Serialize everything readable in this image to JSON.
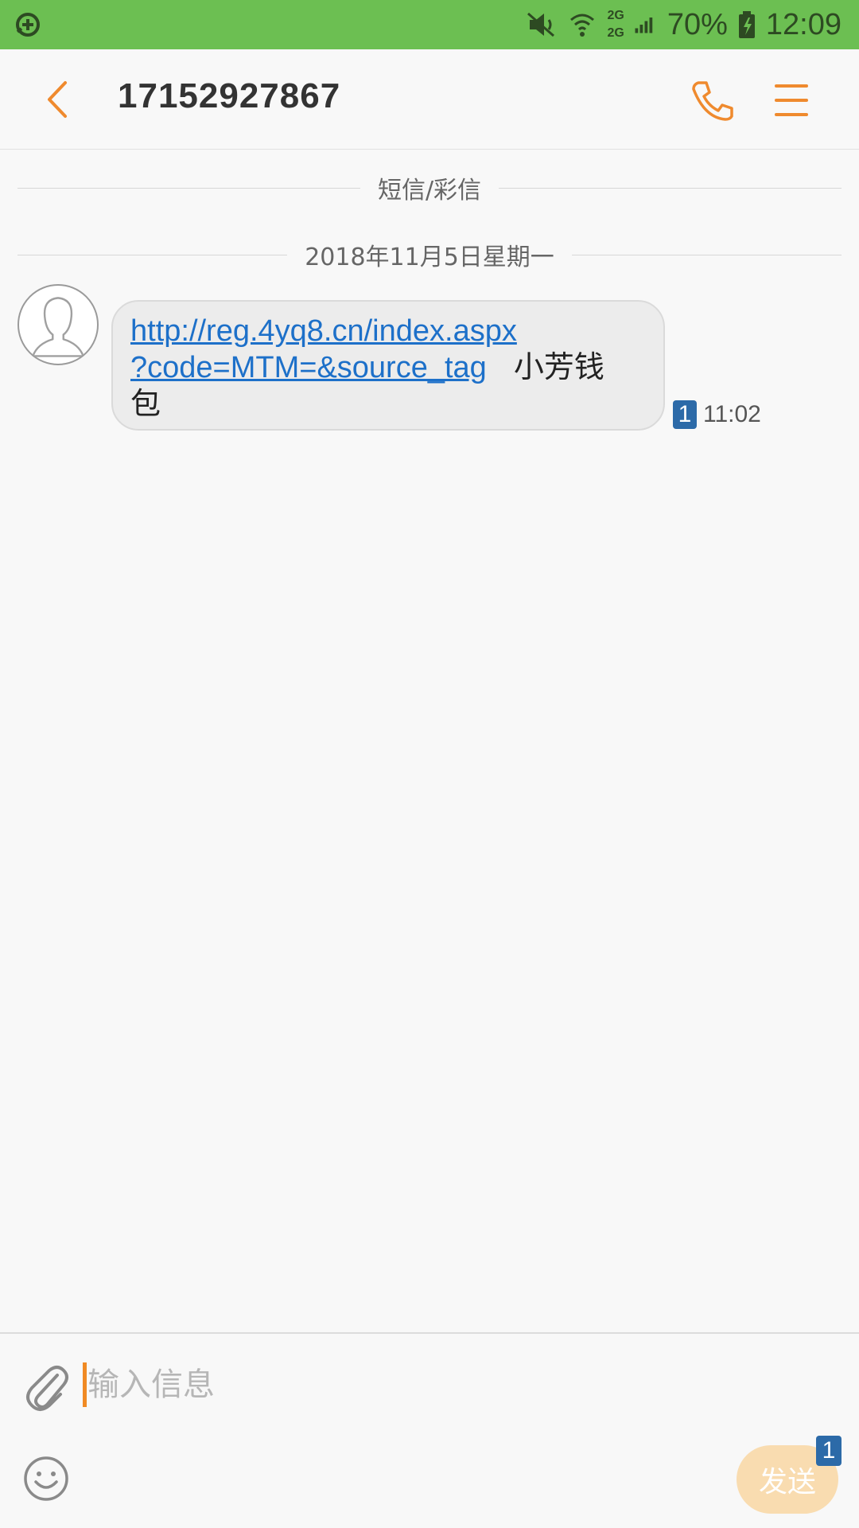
{
  "status_bar": {
    "network_label_top": "2G",
    "network_label_bottom": "2G",
    "battery_percent": "70%",
    "time": "12:09",
    "background_color": "#6cbf52",
    "icons": [
      "app-notification-icon",
      "mute-icon",
      "wifi-icon",
      "signal-icon",
      "battery-charging-icon"
    ]
  },
  "header": {
    "contact_number": "17152927867",
    "accent_color": "#ef8a2e",
    "icons": [
      "back-arrow-icon",
      "phone-icon",
      "menu-icon"
    ]
  },
  "conversation": {
    "type_separator": "短信/彩信",
    "date_separator": "2018年11月5日星期一",
    "messages": [
      {
        "link_part1": "http://reg.4yq8.cn/index.aspx",
        "link_part2": "?code=MTM=&source_tag",
        "text_tail_1": "小芳钱",
        "text_tail_2": "包",
        "sim_slot": "1",
        "time": "11:02"
      }
    ]
  },
  "compose": {
    "placeholder": "输入信息",
    "send_label": "发送",
    "sim_slot": "1",
    "icons": [
      "attach-icon",
      "emoji-icon"
    ]
  }
}
